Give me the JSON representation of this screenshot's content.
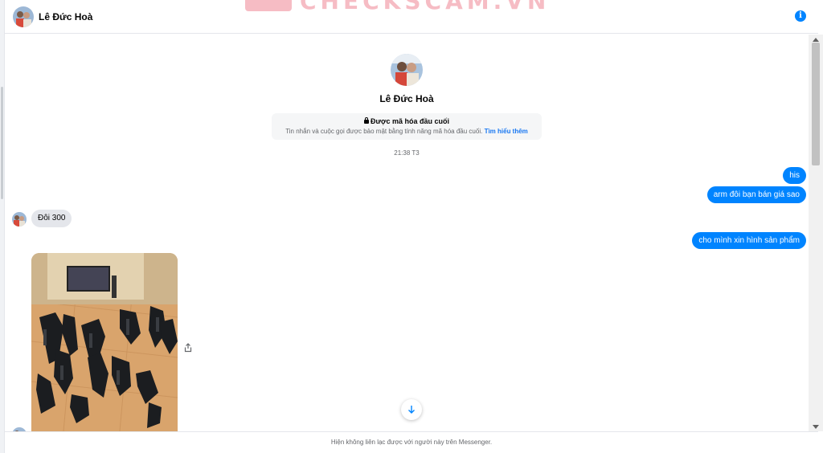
{
  "header": {
    "contact_name": "Lê Đức Hoà",
    "watermark_text": "CHECKSCAM.VN",
    "info_symbol": "i"
  },
  "profile": {
    "name": "Lê Đức Hoà"
  },
  "encryption": {
    "title": "Được mã hóa đầu cuối",
    "text": "Tin nhắn và cuộc gọi được bảo mật bằng tính năng mã hóa đầu cuối.",
    "link": "Tìm hiểu thêm"
  },
  "timestamp": "21:38 T3",
  "messages": {
    "out_1": "his",
    "out_2": "arm đôi bạn bán giá sao",
    "in_1": "Đôi 300",
    "out_3": "cho mình xin hình sản phẩm"
  },
  "footer": {
    "notice": "Hiện không liên lạc được với người này trên Messenger."
  },
  "colors": {
    "outgoing_bubble": "#0084ff",
    "incoming_bubble": "#e4e6eb",
    "link": "#1877f2",
    "watermark": "#e8435a"
  },
  "icons": [
    "info-icon",
    "lock-icon",
    "share-icon",
    "arrow-down-icon"
  ]
}
